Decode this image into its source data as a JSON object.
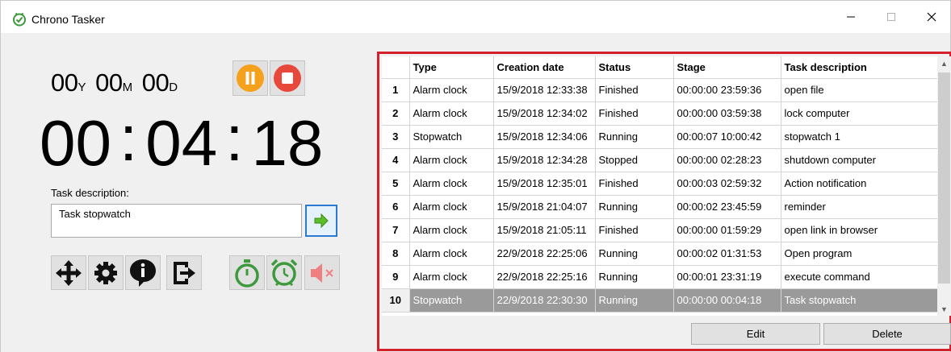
{
  "window": {
    "title": "Chrono Tasker",
    "icon": "check-clock-icon",
    "controls": {
      "minimize": "—",
      "maximize": "☐",
      "close": "✕"
    }
  },
  "timer": {
    "years": "00",
    "years_unit": "Y",
    "months": "00",
    "months_unit": "M",
    "days": "00",
    "days_unit": "D",
    "hours": "00",
    "minutes": "04",
    "seconds": "18",
    "separator": ":"
  },
  "controls": {
    "pause_icon": "pause-icon",
    "stop_icon": "stop-icon",
    "pause_color": "#f5a11c",
    "stop_color": "#e8483c"
  },
  "task": {
    "label": "Task description:",
    "value": "Task stopwatch",
    "submit_icon": "arrow-right-icon"
  },
  "tools": [
    "move-icon",
    "gear-icon",
    "info-icon",
    "exit-icon",
    "stopwatch-icon",
    "alarm-clock-icon",
    "mute-icon"
  ],
  "grid": {
    "columns": [
      "Type",
      "Creation date",
      "Status",
      "Stage",
      "Task description"
    ],
    "rows": [
      [
        "1",
        "Alarm clock",
        "15/9/2018 12:33:38",
        "Finished",
        "00:00:00 23:59:36",
        "open file"
      ],
      [
        "2",
        "Alarm clock",
        "15/9/2018 12:34:02",
        "Finished",
        "00:00:00 03:59:38",
        "lock computer"
      ],
      [
        "3",
        "Stopwatch",
        "15/9/2018 12:34:06",
        "Running",
        "00:00:07 10:00:42",
        "stopwatch 1"
      ],
      [
        "4",
        "Alarm clock",
        "15/9/2018 12:34:28",
        "Stopped",
        "00:00:00 02:28:23",
        "shutdown computer"
      ],
      [
        "5",
        "Alarm clock",
        "15/9/2018 12:35:01",
        "Finished",
        "00:00:03 02:59:32",
        "Action notification"
      ],
      [
        "6",
        "Alarm clock",
        "15/9/2018 21:04:07",
        "Running",
        "00:00:02 23:45:59",
        "reminder"
      ],
      [
        "7",
        "Alarm clock",
        "15/9/2018 21:05:11",
        "Finished",
        "00:00:00 01:59:29",
        "open link in browser"
      ],
      [
        "8",
        "Alarm clock",
        "22/9/2018 22:25:06",
        "Running",
        "00:00:02 01:31:53",
        "Open program"
      ],
      [
        "9",
        "Alarm clock",
        "22/9/2018 22:25:16",
        "Running",
        "00:00:01 23:31:19",
        "execute command"
      ],
      [
        "10",
        "Stopwatch",
        "22/9/2018 22:30:30",
        "Running",
        "00:00:00 00:04:18",
        "Task stopwatch"
      ]
    ],
    "selected_row": 10,
    "highlight_color": "#d3202a"
  },
  "actions": {
    "edit": "Edit",
    "delete": "Delete"
  }
}
